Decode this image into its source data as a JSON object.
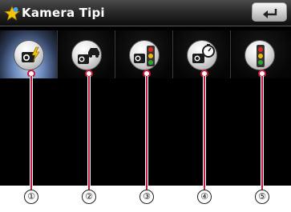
{
  "window": {
    "title": "Kamera Tipi",
    "title_icon": "star-icon",
    "back_icon": "back-arrow-icon"
  },
  "camera_types": [
    {
      "icon": "camera-flash-icon",
      "selected": true
    },
    {
      "icon": "camera-car-icon",
      "selected": false
    },
    {
      "icon": "camera-traffic-light-icon",
      "selected": false
    },
    {
      "icon": "camera-speed-icon",
      "selected": false
    },
    {
      "icon": "traffic-light-icon",
      "selected": false
    }
  ],
  "callouts": [
    "①",
    "②",
    "③",
    "④",
    "⑤"
  ],
  "colors": {
    "screen_bg": "#000000",
    "pointer": "#c2183a",
    "title_text": "#ffffff"
  }
}
